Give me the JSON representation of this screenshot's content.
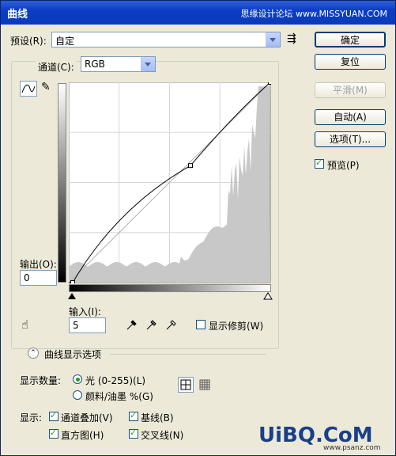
{
  "window": {
    "title": "曲线",
    "watermark": "思缘设计论坛 www.MISSYUAN.COM"
  },
  "preset": {
    "label": "预设(R):",
    "value": "自定"
  },
  "channel": {
    "label": "通道(C):",
    "value": "RGB"
  },
  "buttons": {
    "ok": "确定",
    "reset": "复位",
    "smooth": "平滑(M)",
    "auto": "自动(A)",
    "options": "选项(T)..."
  },
  "preview": {
    "label": "预览(P)",
    "checked": true
  },
  "output": {
    "label": "输出(O):",
    "value": "0"
  },
  "input": {
    "label": "输入(I):",
    "value": "5"
  },
  "show_clipping": {
    "label": "显示修剪(W)",
    "checked": false
  },
  "curve_display": {
    "label": "曲线显示选项"
  },
  "show_amount": {
    "label": "显示数量:",
    "light": "光 (0-255)(L)",
    "pigment": "颜料/油墨 %(G)"
  },
  "show": {
    "label": "显示:",
    "channel_overlay": "通道叠加(V)",
    "baseline": "基线(B)",
    "histogram": "直方图(H)",
    "intersection": "交叉线(N)"
  },
  "curve_points": [
    [
      5,
      0
    ],
    [
      154,
      149
    ],
    [
      255,
      255
    ]
  ],
  "watermark_bottom": {
    "brand": "UiBQ.CoM",
    "site": "www.psanz.com"
  }
}
